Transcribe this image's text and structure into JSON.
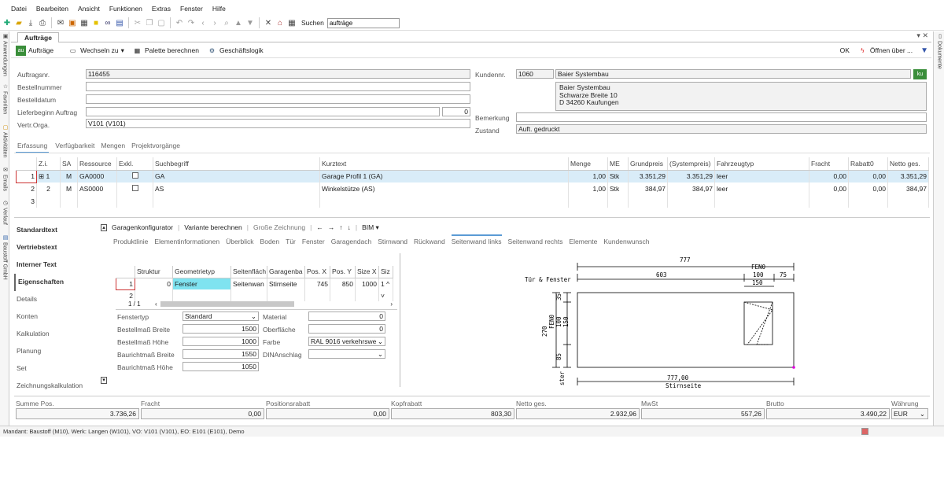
{
  "menu": [
    "Datei",
    "Bearbeiten",
    "Ansicht",
    "Funktionen",
    "Extras",
    "Fenster",
    "Hilfe"
  ],
  "search": {
    "label": "Suchen",
    "value": "aufträge"
  },
  "left_rail": [
    "Anwendungen",
    "Favoriten",
    "Aktivitäten",
    "Emails",
    "Verlauf",
    "Baustoff GmbH"
  ],
  "right_rail": [
    "Dokumente"
  ],
  "tab": {
    "title": "Aufträge"
  },
  "cmd": {
    "aufträge": "Aufträge",
    "wechseln": "Wechseln zu",
    "palette": "Palette berechnen",
    "geschaeft": "Geschäftslogik",
    "ok": "OK",
    "oeffnen": "Öffnen über ...",
    "au_badge": "au",
    "ku_badge": "ku"
  },
  "header": {
    "auftragsnr_label": "Auftragsnr.",
    "auftragsnr": "116455",
    "bestellnummer_label": "Bestellnummer",
    "bestelldatum_label": "Bestelldatum",
    "lieferbeginn_label": "Lieferbeginn Auftrag",
    "lieferbeginn_num": "0",
    "vertr_label": "Vertr.Orga.",
    "vertr": "V101 (V101)",
    "kundennr_label": "Kundennr.",
    "kundennr": "1060",
    "kunde": "Baier Systembau",
    "address": [
      "Baier Systembau",
      "Schwarze Breite 10",
      "D 34260 Kaufungen"
    ],
    "bemerkung_label": "Bemerkung",
    "zustand_label": "Zustand",
    "zustand": "Auft. gedruckt"
  },
  "subtabs": [
    "Erfassung",
    "Verfügbarkeit",
    "Mengen",
    "Projektvorgänge"
  ],
  "positions": {
    "columns": [
      "Z.i.",
      "SA",
      "Ressource",
      "Exkl.",
      "Suchbegriff",
      "Kurztext",
      "Menge",
      "ME",
      "Grundpreis",
      "(Systempreis)",
      "Fahrzeugtyp",
      "Fracht",
      "Rabatt0",
      "Netto ges."
    ],
    "rows": [
      {
        "num": "1",
        "zi": "1",
        "sa": "M",
        "res": "GA0000",
        "such": "GA",
        "kurz": "Garage Profil 1 (GA)",
        "menge": "1,00",
        "me": "Stk",
        "gp": "3.351,29",
        "sp": "3.351,29",
        "fz": "leer",
        "fr": "0,00",
        "rb": "0,00",
        "ng": "3.351,29"
      },
      {
        "num": "2",
        "zi": "2",
        "sa": "M",
        "res": "AS0000",
        "such": "AS",
        "kurz": "Winkelstütze (AS)",
        "menge": "1,00",
        "me": "Stk",
        "gp": "384,97",
        "sp": "384,97",
        "fz": "leer",
        "fr": "0,00",
        "rb": "0,00",
        "ng": "384,97"
      },
      {
        "num": "3"
      }
    ]
  },
  "lower_nav": [
    "Standardtext",
    "Vertriebstext",
    "Interner Text",
    "Eigenschaften",
    "Details",
    "Konten",
    "Kalkulation",
    "Planung",
    "Set",
    "Zeichnungskalkulation"
  ],
  "gtool": {
    "konf": "Garagenkonfigurator",
    "variante": "Variante berechnen",
    "gross": "Große Zeichnung",
    "bim": "BIM"
  },
  "gtabs": [
    "Produktlinie",
    "Elementinformationen",
    "Überblick",
    "Boden",
    "Tür",
    "Fenster",
    "Garagendach",
    "Stirnwand",
    "Rückwand",
    "Seitenwand links",
    "Seitenwand rechts",
    "Elemente",
    "Kundenwunsch"
  ],
  "geo": {
    "columns": [
      "Struktur",
      "Geometrietyp",
      "Seitenfläch",
      "Garagenba",
      "Pos. X",
      "Pos. Y",
      "Size X",
      "Siz"
    ],
    "row": {
      "num": "1",
      "struktur": "0",
      "typ": "Fenster",
      "seite": "Seitenwan",
      "garage": "Stirnseite",
      "px": "745",
      "py": "850",
      "sx": "1000",
      "s2": "1"
    },
    "row2": "2",
    "pager": "1 / 1"
  },
  "props": {
    "fenstertyp_l": "Fenstertyp",
    "fenstertyp": "Standard",
    "breite_l": "Bestellmaß Breite",
    "breite": "1500",
    "hoehe_l": "Bestellmaß Höhe",
    "hoehe": "1000",
    "bbreite_l": "Baurichtmaß Breite",
    "bbreite": "1550",
    "bhoehe_l": "Baurichtmaß Höhe",
    "bhoehe": "1050",
    "material_l": "Material",
    "material": "0",
    "oberflaeche_l": "Oberfläche",
    "oberflaeche": "0",
    "farbe_l": "Farbe",
    "farbe": "RAL 9016 verkehrswe",
    "din_l": "DINAnschlag"
  },
  "drawing": {
    "w777": "777",
    "fen": "FEN0",
    "d603": "603",
    "d100": "100",
    "d75": "75",
    "d150": "150",
    "tuer": "Tür & Fenster",
    "left35": "35",
    "d270": "270",
    "fen2": "FEN0",
    "d100b": "100",
    "d150b": "150",
    "d85": "85",
    "w777b": "777,00",
    "stirn": "Stirnseite",
    "ster": "ster"
  },
  "totals": [
    {
      "l": "Summe Pos.",
      "v": "3.736,26"
    },
    {
      "l": "Fracht",
      "v": "0,00"
    },
    {
      "l": "Positionsrabatt",
      "v": "0,00"
    },
    {
      "l": "Kopfrabatt",
      "v": "803,30"
    },
    {
      "l": "Netto ges.",
      "v": "2.932,96"
    },
    {
      "l": "MwSt",
      "v": "557,26"
    },
    {
      "l": "Brutto",
      "v": "3.490,22"
    },
    {
      "l": "Währung",
      "v": "EUR"
    }
  ],
  "status": "Mandant: Baustoff (M10),  Werk: Langen (W101),  VO: V101 (V101),  EO: E101 (E101), Demo"
}
